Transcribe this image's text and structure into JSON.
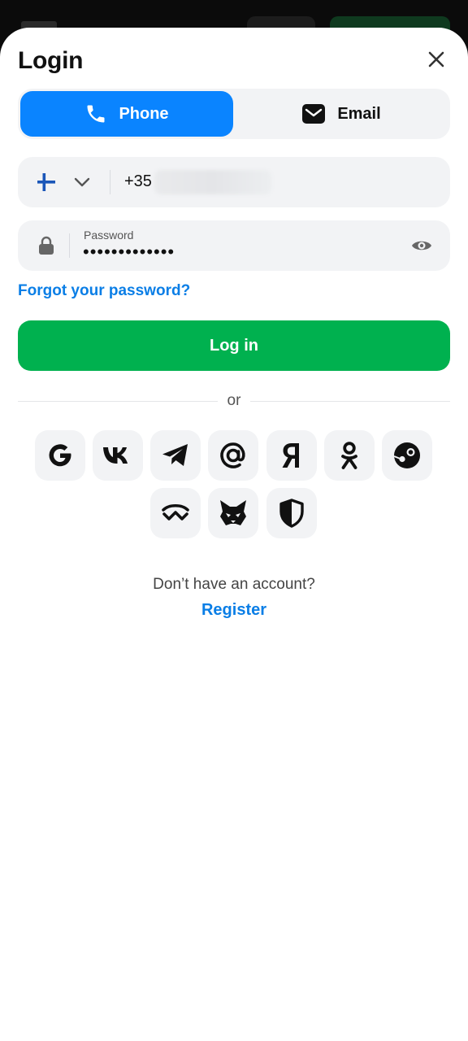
{
  "dialog": {
    "title": "Login"
  },
  "tabs": [
    {
      "label": "Phone",
      "icon": "phone-icon",
      "active": true
    },
    {
      "label": "Email",
      "icon": "mail-icon",
      "active": false
    }
  ],
  "phone": {
    "prefix": "+35",
    "flag": "finland-flag-icon"
  },
  "password": {
    "label": "Password",
    "masked_value": "•••••••••••••"
  },
  "forgot_link": "Forgot your password?",
  "login_button": "Log in",
  "divider": "or",
  "social_icons": [
    "google-icon",
    "vk-icon",
    "telegram-icon",
    "mail-ru-icon",
    "yandex-icon",
    "odnoklassniki-icon",
    "steam-icon",
    "walletconnect-icon",
    "metamask-icon",
    "shield-icon"
  ],
  "footer": {
    "question": "Don’t have an account?",
    "register": "Register"
  },
  "colors": {
    "accent_blue": "#0a84ff",
    "link_blue": "#0a7ee6",
    "green": "#00b14f",
    "field_bg": "#f2f3f5"
  }
}
